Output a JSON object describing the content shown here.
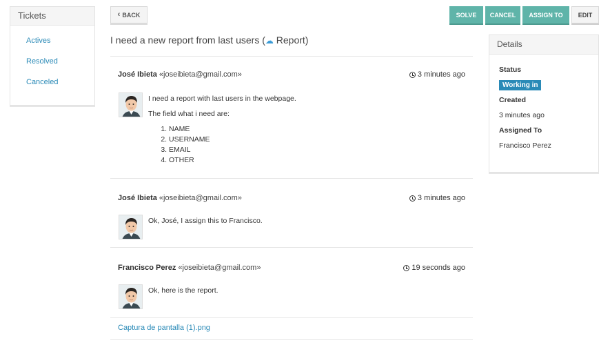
{
  "sidebar": {
    "title": "Tickets",
    "items": [
      {
        "label": "Actives"
      },
      {
        "label": "Resolved"
      },
      {
        "label": "Canceled"
      }
    ]
  },
  "toolbar": {
    "back_label": "BACK",
    "solve_label": "SOLVE",
    "cancel_label": "CANCEL",
    "assign_label": "ASSIGN TO",
    "edit_label": "EDIT"
  },
  "ticket": {
    "title_prefix": "I need a new report from last users (",
    "title_category": "Report",
    "title_suffix": ")",
    "title_icon": "cloud-icon"
  },
  "messages": [
    {
      "author": "José Ibieta",
      "email": "«joseibieta@gmail.com»",
      "time": "3 minutes ago",
      "lines": [
        "I need a report with last users in the webpage.",
        "The field what i need are:"
      ],
      "list": [
        "NAME",
        "USERNAME",
        "EMAIL",
        "OTHER"
      ]
    },
    {
      "author": "José Ibieta",
      "email": "«joseibieta@gmail.com»",
      "time": "3 minutes ago",
      "lines": [
        "Ok, José, I assign this to Francisco."
      ]
    },
    {
      "author": "Francisco Perez",
      "email": "«joseibieta@gmail.com»",
      "time": "19 seconds ago",
      "lines": [
        "Ok, here is the report."
      ]
    }
  ],
  "attachment": {
    "label": "Captura de pantalla (1).png"
  },
  "details": {
    "title": "Details",
    "status_label": "Status",
    "status_value": "Working in",
    "created_label": "Created",
    "created_value": "3 minutes ago",
    "assigned_label": "Assigned To",
    "assigned_value": "Francisco Perez"
  },
  "colors": {
    "accent": "#5fb4a9",
    "link": "#2a8ab7",
    "badge": "#2a8ab7"
  }
}
